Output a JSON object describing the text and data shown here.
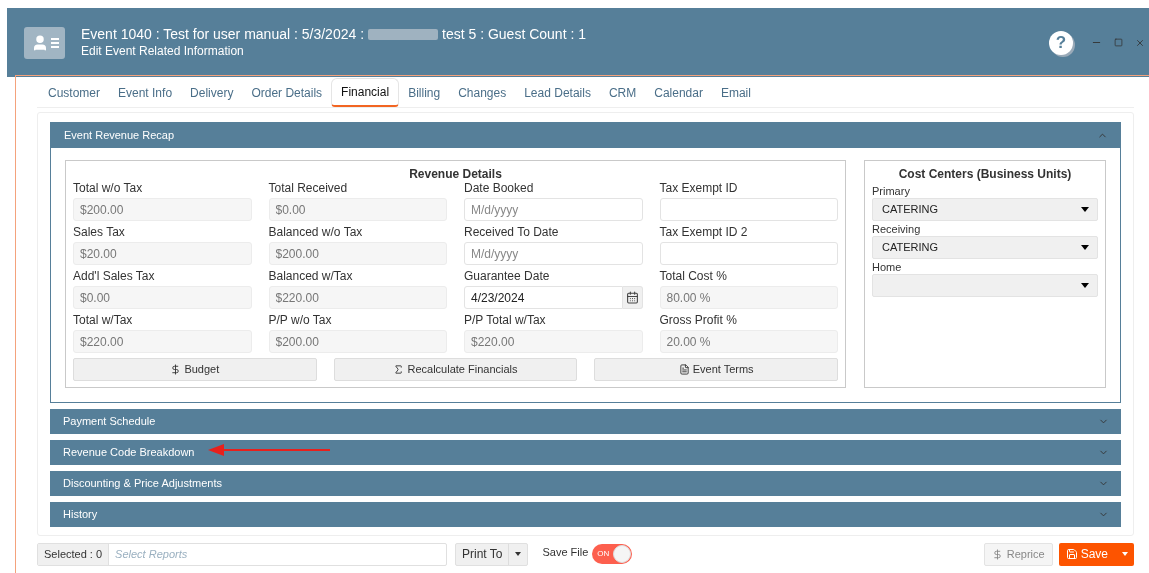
{
  "window": {
    "title_start": "Event 1040 : Test for user manual : 5/3/2024 :",
    "title_end": "test 5 : Guest Count : 1",
    "subtitle": "Edit Event Related Information",
    "help": "?"
  },
  "tabs": [
    {
      "label": "Customer",
      "selected": false
    },
    {
      "label": "Event Info",
      "selected": false
    },
    {
      "label": "Delivery",
      "selected": false
    },
    {
      "label": "Order Details",
      "selected": false
    },
    {
      "label": "Financial",
      "selected": true
    },
    {
      "label": "Billing",
      "selected": false
    },
    {
      "label": "Changes",
      "selected": false
    },
    {
      "label": "Lead Details",
      "selected": false
    },
    {
      "label": "CRM",
      "selected": false
    },
    {
      "label": "Calendar",
      "selected": false
    },
    {
      "label": "Email",
      "selected": false
    }
  ],
  "sections": [
    {
      "title": "Event Revenue Recap",
      "expanded": true
    },
    {
      "title": "Payment Schedule",
      "expanded": false
    },
    {
      "title": "Revenue Code Breakdown",
      "expanded": false
    },
    {
      "title": "Discounting & Price Adjustments",
      "expanded": false
    },
    {
      "title": "History",
      "expanded": false
    }
  ],
  "revenue_details": {
    "title": "Revenue Details",
    "fields": [
      {
        "label": "Total w/o Tax",
        "value": "$200.00",
        "disabled": true
      },
      {
        "label": "Total Received",
        "value": "$0.00",
        "disabled": true
      },
      {
        "label": "Date Booked",
        "placeholder": "M/d/yyyy",
        "disabled": false
      },
      {
        "label": "Tax Exempt ID",
        "disabled": false
      },
      {
        "label": "Sales Tax",
        "value": "$20.00",
        "disabled": true
      },
      {
        "label": "Balanced w/o Tax",
        "value": "$200.00",
        "disabled": true
      },
      {
        "label": "Received To Date",
        "placeholder": "M/d/yyyy",
        "disabled": false
      },
      {
        "label": "Tax Exempt ID 2",
        "disabled": false
      },
      {
        "label": "Add'l Sales Tax",
        "value": "$0.00",
        "disabled": true
      },
      {
        "label": "Balanced w/Tax",
        "value": "$220.00",
        "disabled": true
      },
      {
        "label": "Guarantee Date",
        "value": "4/23/2024",
        "disabled": false,
        "kind": "date"
      },
      {
        "label": "Total Cost %",
        "value": "80.00 %",
        "disabled": true
      },
      {
        "label": "Total w/Tax",
        "value": "$220.00",
        "disabled": true
      },
      {
        "label": "P/P w/o Tax",
        "value": "$200.00",
        "disabled": true
      },
      {
        "label": "P/P Total w/Tax",
        "value": "$220.00",
        "disabled": true
      },
      {
        "label": "Gross Profit %",
        "value": "20.00 %",
        "disabled": true
      }
    ],
    "buttons": [
      {
        "label": "Budget",
        "kind": "budget"
      },
      {
        "label": "Recalculate Financials",
        "kind": "recalc"
      },
      {
        "label": "Event Terms",
        "kind": "terms"
      }
    ]
  },
  "cost_centers": {
    "title": "Cost Centers (Business Units)",
    "selects": [
      {
        "label": "Primary",
        "value": "CATERING"
      },
      {
        "label": "Receiving",
        "value": "CATERING"
      },
      {
        "label": "Home"
      }
    ]
  },
  "footer": {
    "selected": "Selected : 0",
    "reports_placeholder": "Select Reports",
    "print_to": "Print To",
    "save_file_label": "Save File",
    "save_file": {
      "on": true,
      "label": "ON"
    },
    "reprice": "Reprice",
    "save": "Save"
  }
}
